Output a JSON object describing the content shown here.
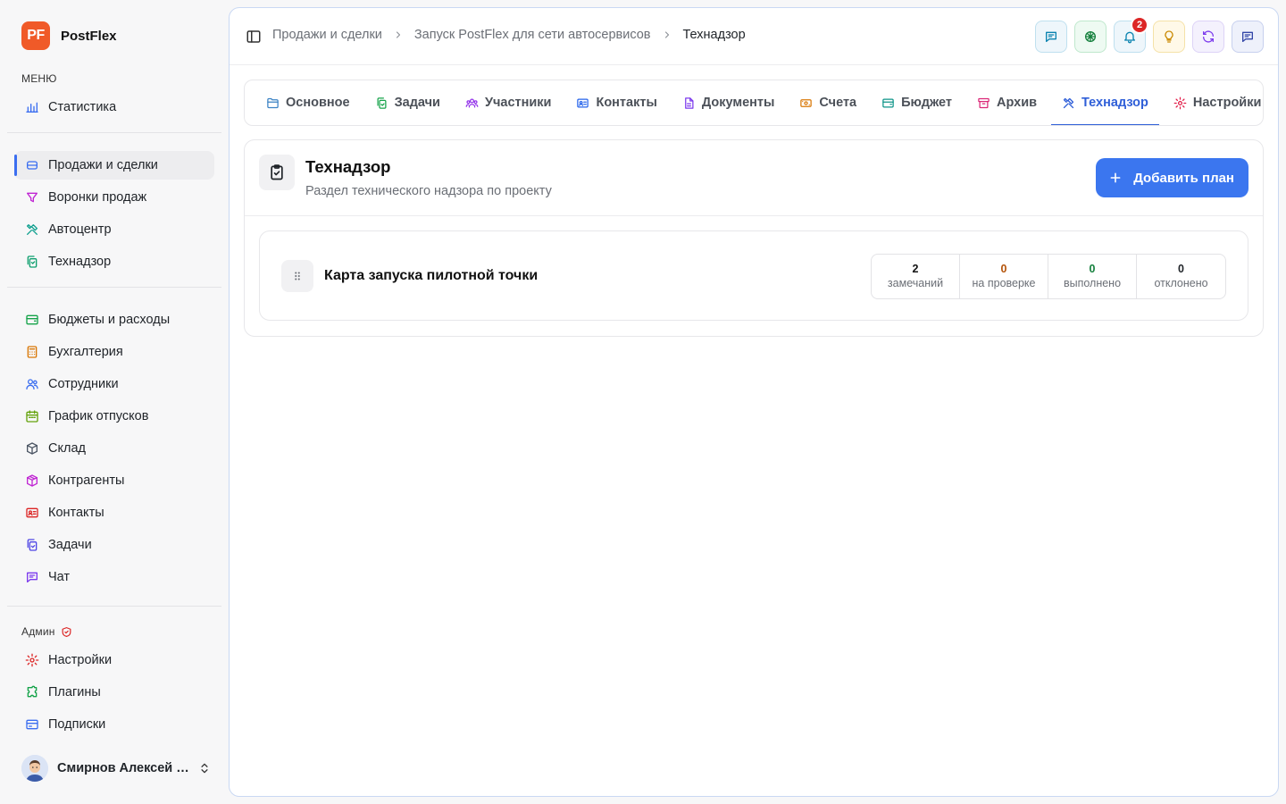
{
  "brand": {
    "logo_text": "PF",
    "name": "PostFlex",
    "logo_color": "#f05a28"
  },
  "sidebar": {
    "menu_label": "МЕНЮ",
    "group1": [
      {
        "label": "Статистика",
        "icon": "bar-chart-icon",
        "color": "#3b6ef0"
      }
    ],
    "group2": [
      {
        "label": "Продажи и сделки",
        "icon": "layers-icon",
        "color": "#3b6ef0",
        "active": true
      },
      {
        "label": "Воронки продаж",
        "icon": "funnel-icon",
        "color": "#c026d3"
      },
      {
        "label": "Автоцентр",
        "icon": "tools-icon",
        "color": "#0e9f8e"
      },
      {
        "label": "Технадзор",
        "icon": "clipboard-copy-icon",
        "color": "#0e9f6e"
      }
    ],
    "group3": [
      {
        "label": "Бюджеты и расходы",
        "icon": "wallet-icon",
        "color": "#16a34a"
      },
      {
        "label": "Бухгалтерия",
        "icon": "calculator-icon",
        "color": "#d97706"
      },
      {
        "label": "Сотрудники",
        "icon": "users-icon",
        "color": "#3b6ef0"
      },
      {
        "label": "График отпусков",
        "icon": "calendar-icon",
        "color": "#65a30d"
      },
      {
        "label": "Склад",
        "icon": "box-icon",
        "color": "#4b5563"
      },
      {
        "label": "Контрагенты",
        "icon": "package-icon",
        "color": "#c026d3"
      },
      {
        "label": "Контакты",
        "icon": "contact-card-icon",
        "color": "#dc2626"
      },
      {
        "label": "Задачи",
        "icon": "task-copy-icon",
        "color": "#4f46e5"
      },
      {
        "label": "Чат",
        "icon": "chat-icon",
        "color": "#7c3aed"
      }
    ],
    "admin_label": "Админ",
    "group4": [
      {
        "label": "Настройки",
        "icon": "gear-icon",
        "color": "#dc2626"
      },
      {
        "label": "Плагины",
        "icon": "puzzle-icon",
        "color": "#16a34a"
      },
      {
        "label": "Подписки",
        "icon": "credit-card-icon",
        "color": "#3b6ef0"
      }
    ],
    "user_name": "Смирнов Алексей Иванович"
  },
  "breadcrumb": {
    "items": [
      "Продажи и сделки",
      "Запуск PostFlex для сети автосервисов",
      "Технадзор"
    ]
  },
  "top_actions": {
    "notifications_count": "2"
  },
  "tabs": [
    {
      "label": "Основное",
      "icon": "folder-icon",
      "color": "#3b82c4"
    },
    {
      "label": "Задачи",
      "icon": "task-copy-icon",
      "color": "#16a34a"
    },
    {
      "label": "Участники",
      "icon": "team-icon",
      "color": "#9333ea"
    },
    {
      "label": "Контакты",
      "icon": "contact-card-icon",
      "color": "#2563eb"
    },
    {
      "label": "Документы",
      "icon": "document-icon",
      "color": "#7c3aed"
    },
    {
      "label": "Счета",
      "icon": "money-icon",
      "color": "#d97706"
    },
    {
      "label": "Бюджет",
      "icon": "wallet-icon",
      "color": "#0d9488"
    },
    {
      "label": "Архив",
      "icon": "archive-icon",
      "color": "#db2777"
    },
    {
      "label": "Технадзор",
      "icon": "tools-icon",
      "color": "#2f5fd8",
      "active": true
    },
    {
      "label": "Настройки",
      "icon": "gear-icon",
      "color": "#e11d48"
    }
  ],
  "section": {
    "title": "Технадзор",
    "subtitle": "Раздел технического надзора по проекту",
    "add_button": "Добавить план",
    "accent": "#3b76ef"
  },
  "plans": [
    {
      "title": "Карта запуска пилотной точки",
      "stats": [
        {
          "value": "2",
          "label": "замечаний",
          "color": "#111111"
        },
        {
          "value": "0",
          "label": "на проверке",
          "color": "#b45309"
        },
        {
          "value": "0",
          "label": "выполнено",
          "color": "#15803d"
        },
        {
          "value": "0",
          "label": "отклонено",
          "color": "#1f2328"
        }
      ]
    }
  ]
}
